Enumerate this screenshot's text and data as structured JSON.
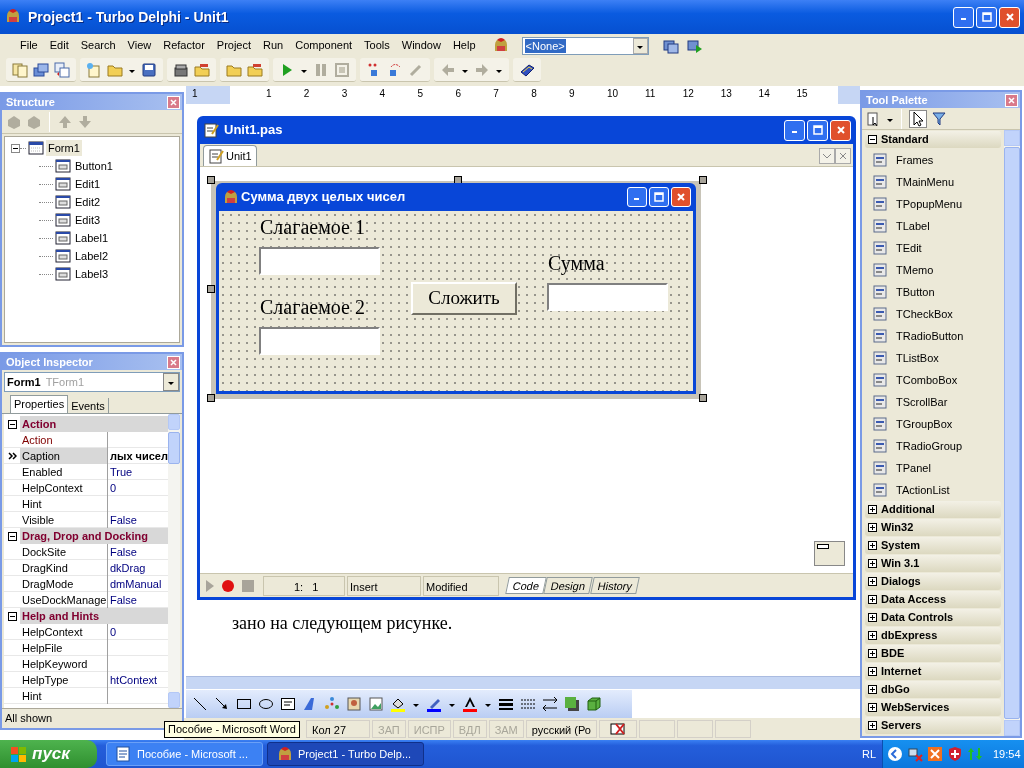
{
  "window": {
    "title": "Project1 - Turbo Delphi - Unit1"
  },
  "menu": [
    "File",
    "Edit",
    "Search",
    "View",
    "Refactor",
    "Project",
    "Run",
    "Component",
    "Tools",
    "Window",
    "Help"
  ],
  "project_combo": {
    "value": "<None>"
  },
  "ruler": [
    "1",
    "1",
    "2",
    "3",
    "4",
    "5",
    "6",
    "7",
    "8",
    "9",
    "10",
    "11",
    "12",
    "13",
    "14",
    "15"
  ],
  "structure": {
    "title": "Structure",
    "tree": [
      {
        "label": "Form1",
        "selected": true,
        "expanded": true,
        "children": [
          {
            "label": "Button1",
            "selected": false
          },
          {
            "label": "Edit1",
            "selected": false
          },
          {
            "label": "Edit2",
            "selected": false
          },
          {
            "label": "Edit3",
            "selected": false
          },
          {
            "label": "Label1",
            "selected": false
          },
          {
            "label": "Label2",
            "selected": false
          },
          {
            "label": "Label3",
            "selected": false
          }
        ]
      }
    ]
  },
  "object_inspector": {
    "title": "Object Inspector",
    "object": "Form1",
    "class": "TForm1",
    "tabs": [
      {
        "label": "Properties",
        "selected": true
      },
      {
        "label": "Events",
        "selected": false
      }
    ],
    "rows": [
      {
        "kind": "category",
        "label": "Action",
        "expanded": true
      },
      {
        "kind": "reference",
        "name": "Action",
        "value": "",
        "selected": false
      },
      {
        "kind": "property",
        "name": "Caption",
        "value": "лых чисел",
        "selected": true,
        "modified": true
      },
      {
        "kind": "property",
        "name": "Enabled",
        "value": "True",
        "selected": false,
        "modified": false
      },
      {
        "kind": "property",
        "name": "HelpContext",
        "value": "0",
        "selected": false,
        "modified": false
      },
      {
        "kind": "property",
        "name": "Hint",
        "value": "",
        "selected": false
      },
      {
        "kind": "property",
        "name": "Visible",
        "value": "False",
        "selected": false,
        "modified": false
      },
      {
        "kind": "category",
        "label": "Drag, Drop and Docking",
        "expanded": true
      },
      {
        "kind": "property",
        "name": "DockSite",
        "value": "False",
        "selected": false,
        "modified": false
      },
      {
        "kind": "property",
        "name": "DragKind",
        "value": "dkDrag",
        "selected": false,
        "modified": false
      },
      {
        "kind": "property",
        "name": "DragMode",
        "value": "dmManual",
        "selected": false,
        "modified": false
      },
      {
        "kind": "property",
        "name": "UseDockManage",
        "value": "False",
        "selected": false,
        "modified": false
      },
      {
        "kind": "category",
        "label": "Help and Hints",
        "expanded": true
      },
      {
        "kind": "property",
        "name": "HelpContext",
        "value": "0",
        "selected": false,
        "modified": false
      },
      {
        "kind": "property",
        "name": "HelpFile",
        "value": "",
        "selected": false
      },
      {
        "kind": "property",
        "name": "HelpKeyword",
        "value": "",
        "selected": false
      },
      {
        "kind": "property",
        "name": "HelpType",
        "value": "htContext",
        "selected": false,
        "modified": false
      },
      {
        "kind": "property",
        "name": "Hint",
        "value": "",
        "selected": false
      }
    ],
    "status": "All shown"
  },
  "editor": {
    "title": "Unit1.pas",
    "tabs": [
      {
        "label": "Unit1",
        "selected": true
      }
    ],
    "form": {
      "title": "Сумма двух целых чисел",
      "controls": [
        {
          "kind": "label",
          "text": "Слагаемое 1"
        },
        {
          "kind": "edit"
        },
        {
          "kind": "label",
          "text": "Слагаемое 2"
        },
        {
          "kind": "edit"
        },
        {
          "kind": "button",
          "text": "Сложить"
        },
        {
          "kind": "label",
          "text": "Сумма"
        },
        {
          "kind": "edit"
        }
      ]
    },
    "status": {
      "position": "1:   1",
      "mode": "Insert",
      "state": "Modified"
    },
    "view_tabs": [
      {
        "label": "Code",
        "selected": true
      },
      {
        "label": "Design",
        "selected": false
      },
      {
        "label": "History",
        "selected": false
      }
    ]
  },
  "document": {
    "text": "зано на следующем рисунке."
  },
  "tool_palette": {
    "title": "Tool Palette",
    "categories": [
      {
        "label": "Standard",
        "expanded": true,
        "items": [
          "Frames",
          "TMainMenu",
          "TPopupMenu",
          "TLabel",
          "TEdit",
          "TMemo",
          "TButton",
          "TCheckBox",
          "TRadioButton",
          "TListBox",
          "TComboBox",
          "TScrollBar",
          "TGroupBox",
          "TRadioGroup",
          "TPanel",
          "TActionList"
        ]
      },
      {
        "label": "Additional",
        "expanded": false
      },
      {
        "label": "Win32",
        "expanded": false
      },
      {
        "label": "System",
        "expanded": false
      },
      {
        "label": "Win 3.1",
        "expanded": false
      },
      {
        "label": "Dialogs",
        "expanded": false
      },
      {
        "label": "Data Access",
        "expanded": false
      },
      {
        "label": "Data Controls",
        "expanded": false
      },
      {
        "label": "dbExpress",
        "expanded": false
      },
      {
        "label": "BDE",
        "expanded": false
      },
      {
        "label": "Internet",
        "expanded": false
      },
      {
        "label": "dbGo",
        "expanded": false
      },
      {
        "label": "WebServices",
        "expanded": false
      },
      {
        "label": "Servers",
        "expanded": false
      }
    ]
  },
  "word_status": [
    {
      "text": "Кол 27",
      "disabled": false
    },
    {
      "text": "ЗАП",
      "disabled": true
    },
    {
      "text": "ИСПР",
      "disabled": true
    },
    {
      "text": "ВДЛ",
      "disabled": true
    },
    {
      "text": "ЗАМ",
      "disabled": true
    },
    {
      "text": "русский (Ро",
      "disabled": false
    }
  ],
  "tooltip": "Пособие - Microsoft Word",
  "taskbar": {
    "start": "пуск",
    "tasks": [
      {
        "label": "Пособие - Microsoft ...",
        "selected": false
      },
      {
        "label": "Project1 - Turbo Delp...",
        "selected": true
      }
    ],
    "language": "RL",
    "clock": "19:54"
  }
}
